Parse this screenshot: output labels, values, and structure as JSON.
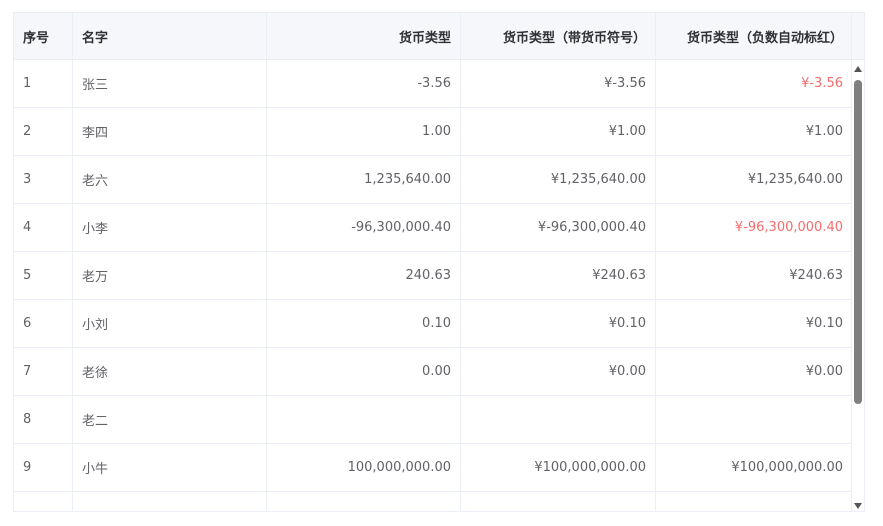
{
  "table": {
    "headers": [
      "序号",
      "名字",
      "货币类型",
      "货币类型（带货币符号）",
      "货币类型（负数自动标红）"
    ],
    "rows": [
      {
        "index": "1",
        "name": "张三",
        "amount": "-3.56",
        "amount_symbol": "¥-3.56",
        "amount_red": "¥-3.56",
        "negative": true
      },
      {
        "index": "2",
        "name": "李四",
        "amount": "1.00",
        "amount_symbol": "¥1.00",
        "amount_red": "¥1.00",
        "negative": false
      },
      {
        "index": "3",
        "name": "老六",
        "amount": "1,235,640.00",
        "amount_symbol": "¥1,235,640.00",
        "amount_red": "¥1,235,640.00",
        "negative": false
      },
      {
        "index": "4",
        "name": "小李",
        "amount": "-96,300,000.40",
        "amount_symbol": "¥-96,300,000.40",
        "amount_red": "¥-96,300,000.40",
        "negative": true
      },
      {
        "index": "5",
        "name": "老万",
        "amount": "240.63",
        "amount_symbol": "¥240.63",
        "amount_red": "¥240.63",
        "negative": false
      },
      {
        "index": "6",
        "name": "小刘",
        "amount": "0.10",
        "amount_symbol": "¥0.10",
        "amount_red": "¥0.10",
        "negative": false
      },
      {
        "index": "7",
        "name": "老徐",
        "amount": "0.00",
        "amount_symbol": "¥0.00",
        "amount_red": "¥0.00",
        "negative": false
      },
      {
        "index": "8",
        "name": "老二",
        "amount": "",
        "amount_symbol": "",
        "amount_red": "",
        "negative": false
      },
      {
        "index": "9",
        "name": "小牛",
        "amount": "100,000,000.00",
        "amount_symbol": "¥100,000,000.00",
        "amount_red": "¥100,000,000.00",
        "negative": false
      }
    ]
  },
  "colors": {
    "negative": "#f56c6c",
    "header_bg": "#f5f7fa",
    "border": "#ebeef5"
  }
}
